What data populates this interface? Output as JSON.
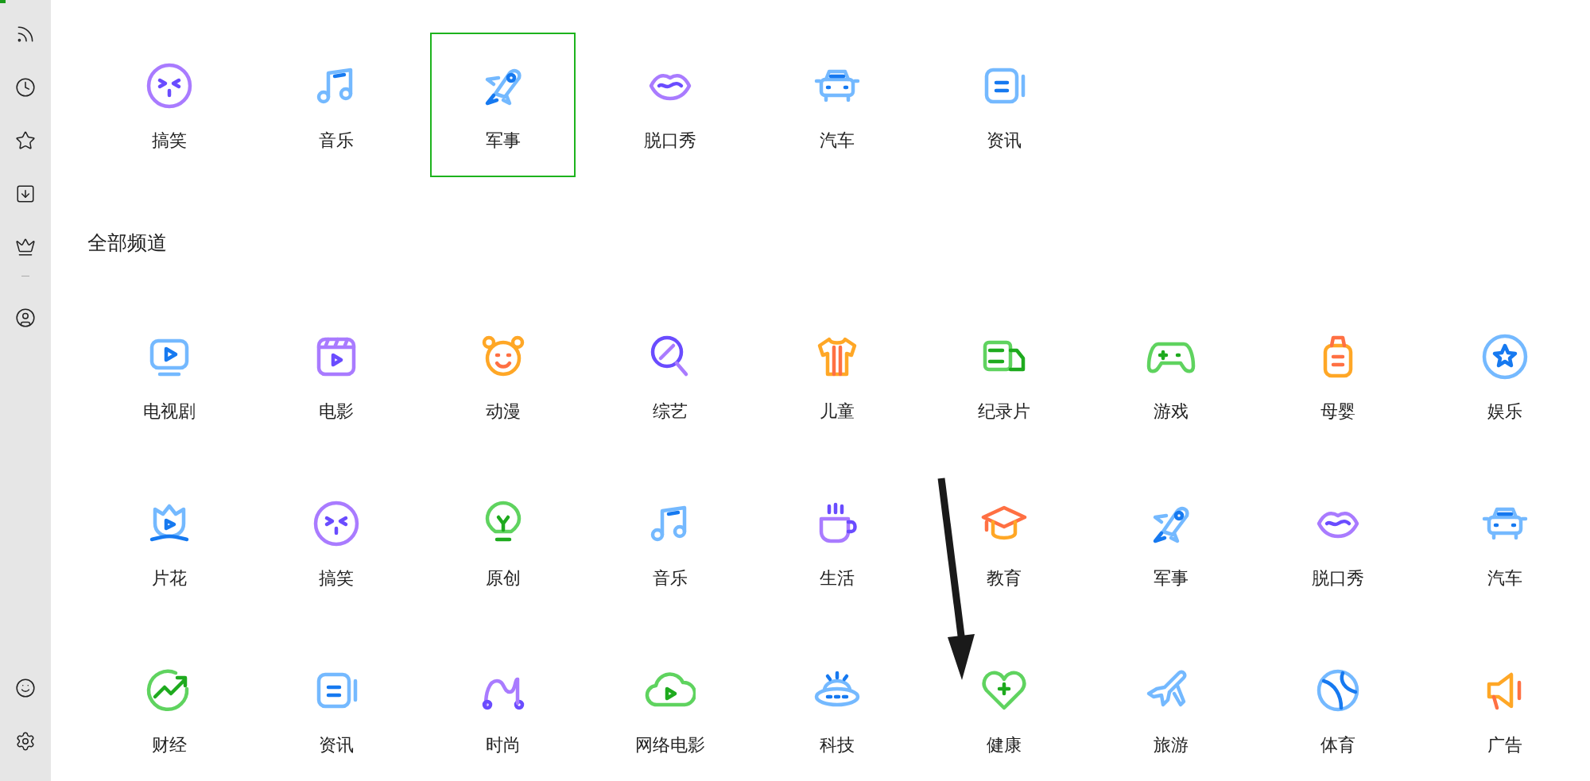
{
  "sidebar": {
    "top_items": [
      {
        "kind": "rss"
      },
      {
        "kind": "history"
      },
      {
        "kind": "star"
      },
      {
        "kind": "download"
      },
      {
        "kind": "crown"
      }
    ],
    "middle_items": [
      {
        "kind": "user"
      }
    ],
    "bottom_items": [
      {
        "kind": "smile"
      },
      {
        "kind": "settings"
      }
    ]
  },
  "recent_channels": [
    {
      "label": "搞笑",
      "kind": "laugh",
      "selected": false
    },
    {
      "label": "音乐",
      "kind": "music",
      "selected": false
    },
    {
      "label": "军事",
      "kind": "rocket",
      "selected": true
    },
    {
      "label": "脱口秀",
      "kind": "lips",
      "selected": false
    },
    {
      "label": "汽车",
      "kind": "car",
      "selected": false
    },
    {
      "label": "资讯",
      "kind": "news",
      "selected": false
    }
  ],
  "all_channels": {
    "title": "全部频道",
    "items": [
      {
        "label": "电视剧",
        "kind": "tv"
      },
      {
        "label": "电影",
        "kind": "film"
      },
      {
        "label": "动漫",
        "kind": "bear"
      },
      {
        "label": "综艺",
        "kind": "lollipop"
      },
      {
        "label": "儿童",
        "kind": "shirt"
      },
      {
        "label": "纪录片",
        "kind": "truck"
      },
      {
        "label": "游戏",
        "kind": "gamepad"
      },
      {
        "label": "母婴",
        "kind": "bottle"
      },
      {
        "label": "娱乐",
        "kind": "starcircle"
      },
      {
        "label": "片花",
        "kind": "tulip"
      },
      {
        "label": "搞笑",
        "kind": "laugh"
      },
      {
        "label": "原创",
        "kind": "bulb"
      },
      {
        "label": "音乐",
        "kind": "music"
      },
      {
        "label": "生活",
        "kind": "cup"
      },
      {
        "label": "教育",
        "kind": "cap"
      },
      {
        "label": "军事",
        "kind": "rocket"
      },
      {
        "label": "脱口秀",
        "kind": "lips"
      },
      {
        "label": "汽车",
        "kind": "car"
      },
      {
        "label": "财经",
        "kind": "chart"
      },
      {
        "label": "资讯",
        "kind": "news"
      },
      {
        "label": "时尚",
        "kind": "hanger"
      },
      {
        "label": "网络电影",
        "kind": "cloud"
      },
      {
        "label": "科技",
        "kind": "ufo"
      },
      {
        "label": "健康",
        "kind": "heart"
      },
      {
        "label": "旅游",
        "kind": "plane"
      },
      {
        "label": "体育",
        "kind": "ball"
      },
      {
        "label": "广告",
        "kind": "megaphone"
      }
    ]
  }
}
